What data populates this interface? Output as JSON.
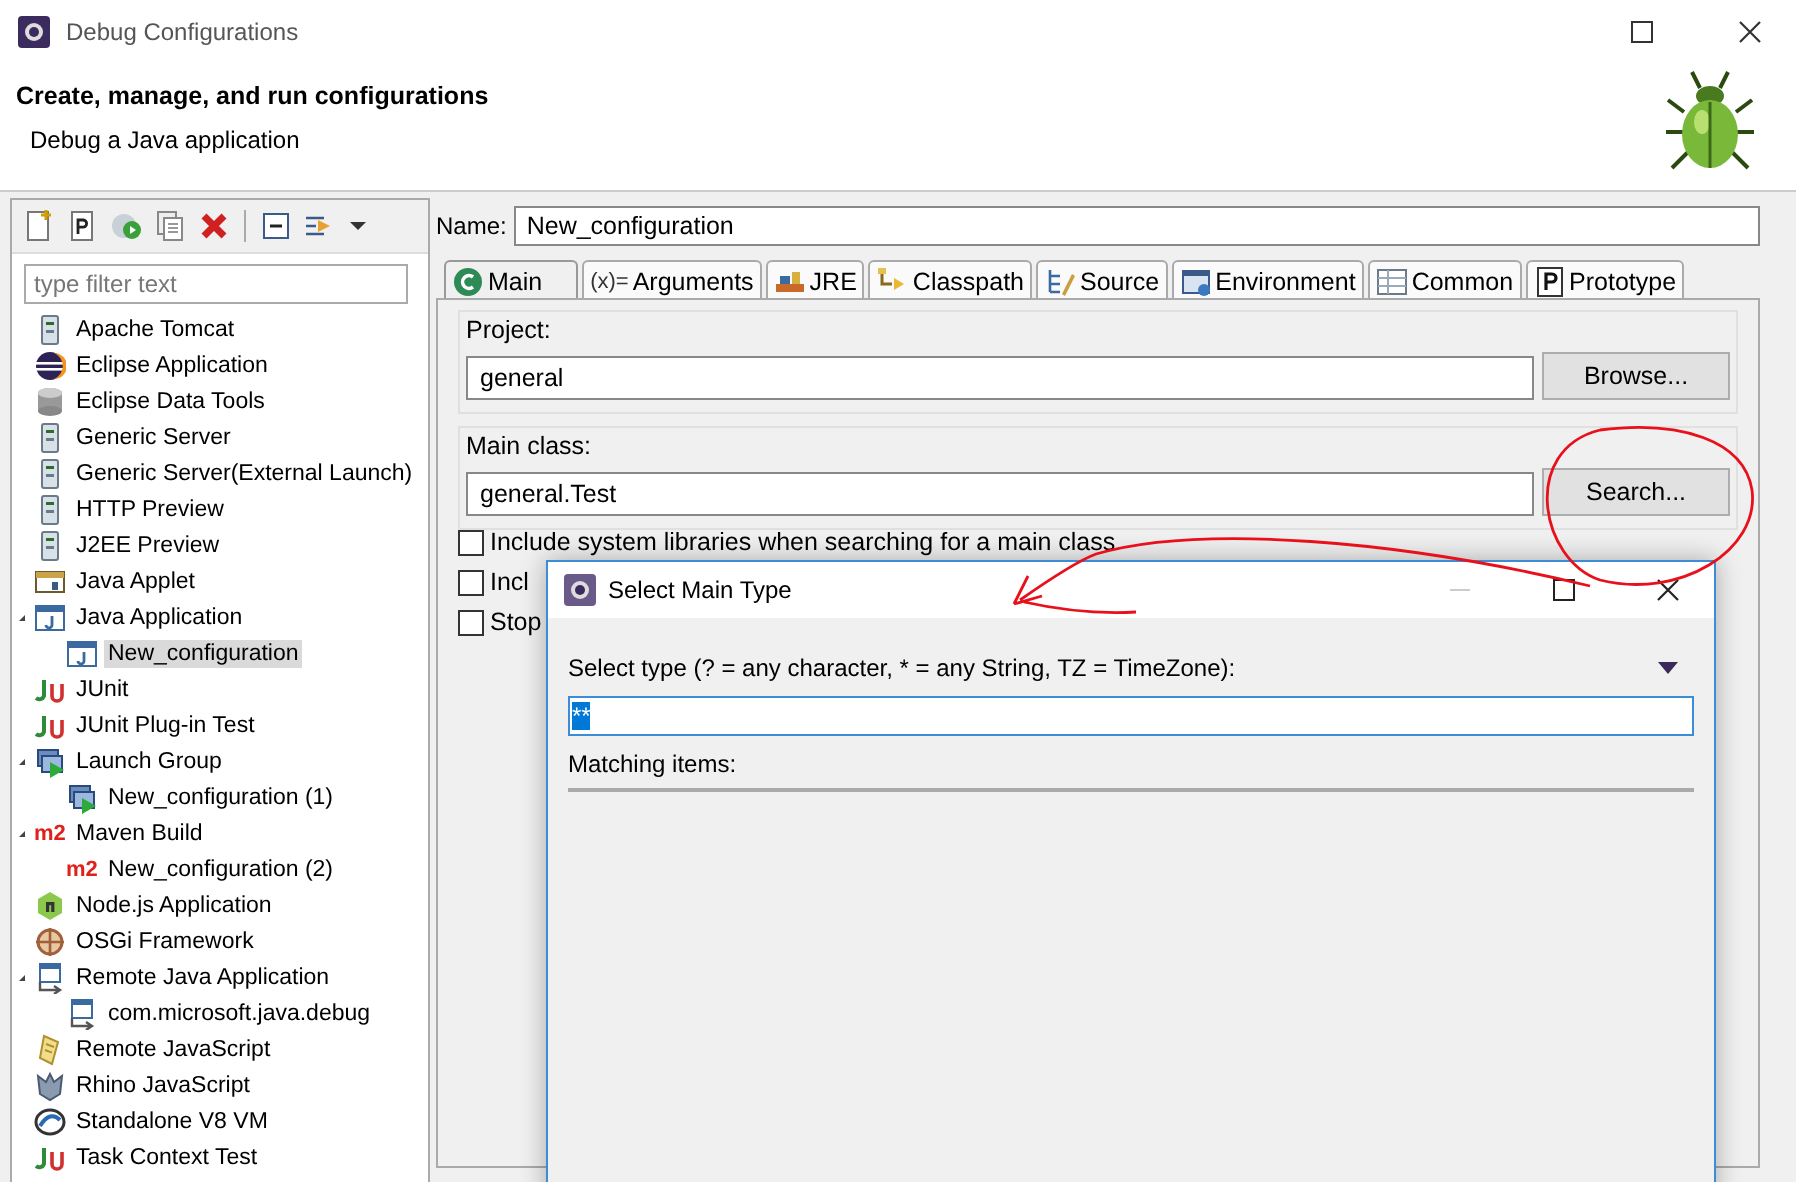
{
  "window": {
    "title": "Debug Configurations"
  },
  "header": {
    "title": "Create, manage, and run configurations",
    "subtitle": "Debug a Java application"
  },
  "sidebar": {
    "filter": {
      "placeholder": "type filter text"
    },
    "tree": [
      {
        "label": "Apache Tomcat",
        "kind": "server",
        "selected": false
      },
      {
        "label": "Eclipse Application",
        "kind": "eclipse",
        "selected": false
      },
      {
        "label": "Eclipse Data Tools",
        "kind": "database",
        "selected": false
      },
      {
        "label": "Generic Server",
        "kind": "server",
        "selected": false
      },
      {
        "label": "Generic Server(External Launch)",
        "kind": "server",
        "selected": false
      },
      {
        "label": "HTTP Preview",
        "kind": "server",
        "selected": false
      },
      {
        "label": "J2EE Preview",
        "kind": "server",
        "selected": false
      },
      {
        "label": "Java Applet",
        "kind": "applet",
        "selected": false
      },
      {
        "label": "Java Application",
        "kind": "java",
        "selected": false,
        "expanded": true,
        "children": [
          {
            "label": "New_configuration",
            "kind": "java",
            "selected": true
          }
        ]
      },
      {
        "label": "JUnit",
        "kind": "junit",
        "selected": false
      },
      {
        "label": "JUnit Plug-in Test",
        "kind": "junit",
        "selected": false
      },
      {
        "label": "Launch Group",
        "kind": "launch",
        "selected": false,
        "expanded": true,
        "children": [
          {
            "label": "New_configuration (1)",
            "kind": "launch",
            "selected": false
          }
        ]
      },
      {
        "label": "Maven Build",
        "kind": "maven",
        "badge": "m2",
        "selected": false,
        "expanded": true,
        "children": [
          {
            "label": "New_configuration (2)",
            "kind": "maven",
            "badge": "m2",
            "selected": false
          }
        ]
      },
      {
        "label": "Node.js Application",
        "kind": "node",
        "selected": false
      },
      {
        "label": "OSGi Framework",
        "kind": "osgi",
        "selected": false
      },
      {
        "label": "Remote Java Application",
        "kind": "remote",
        "selected": false,
        "expanded": true,
        "children": [
          {
            "label": "com.microsoft.java.debug",
            "kind": "remote",
            "selected": false
          }
        ]
      },
      {
        "label": "Remote JavaScript",
        "kind": "script",
        "selected": false
      },
      {
        "label": "Rhino JavaScript",
        "kind": "rhino",
        "selected": false
      },
      {
        "label": "Standalone V8 VM",
        "kind": "v8",
        "selected": false
      },
      {
        "label": "Task Context Test",
        "kind": "junit",
        "selected": false
      }
    ]
  },
  "config": {
    "name_label": "Name:",
    "name_value": "New_configuration",
    "tabs": [
      {
        "label": "Main",
        "kind": "main",
        "selected": true
      },
      {
        "label": "Arguments",
        "icon_text": "(x)=",
        "selected": false
      },
      {
        "label": "JRE",
        "kind": "jre",
        "selected": false
      },
      {
        "label": "Classpath",
        "kind": "classpath",
        "selected": false
      },
      {
        "label": "Source",
        "kind": "source",
        "selected": false
      },
      {
        "label": "Environment",
        "kind": "environment",
        "selected": false
      },
      {
        "label": "Common",
        "kind": "common",
        "selected": false
      },
      {
        "label": "Prototype",
        "kind": "prototype",
        "selected": false
      }
    ],
    "project": {
      "label": "Project:",
      "value": "general",
      "button": "Browse..."
    },
    "main_class": {
      "label": "Main class:",
      "value": "general.Test",
      "button": "Search..."
    },
    "options": [
      {
        "label": "Include system libraries when searching for a main class",
        "checked": false
      },
      {
        "label": "Incl",
        "checked": false
      },
      {
        "label": "Stop",
        "checked": false
      }
    ]
  },
  "dialog": {
    "title": "Select Main Type",
    "prompt": "Select type (? = any character, * = any String, TZ = TimeZone):",
    "pattern": "**",
    "matching_label": "Matching items:"
  }
}
